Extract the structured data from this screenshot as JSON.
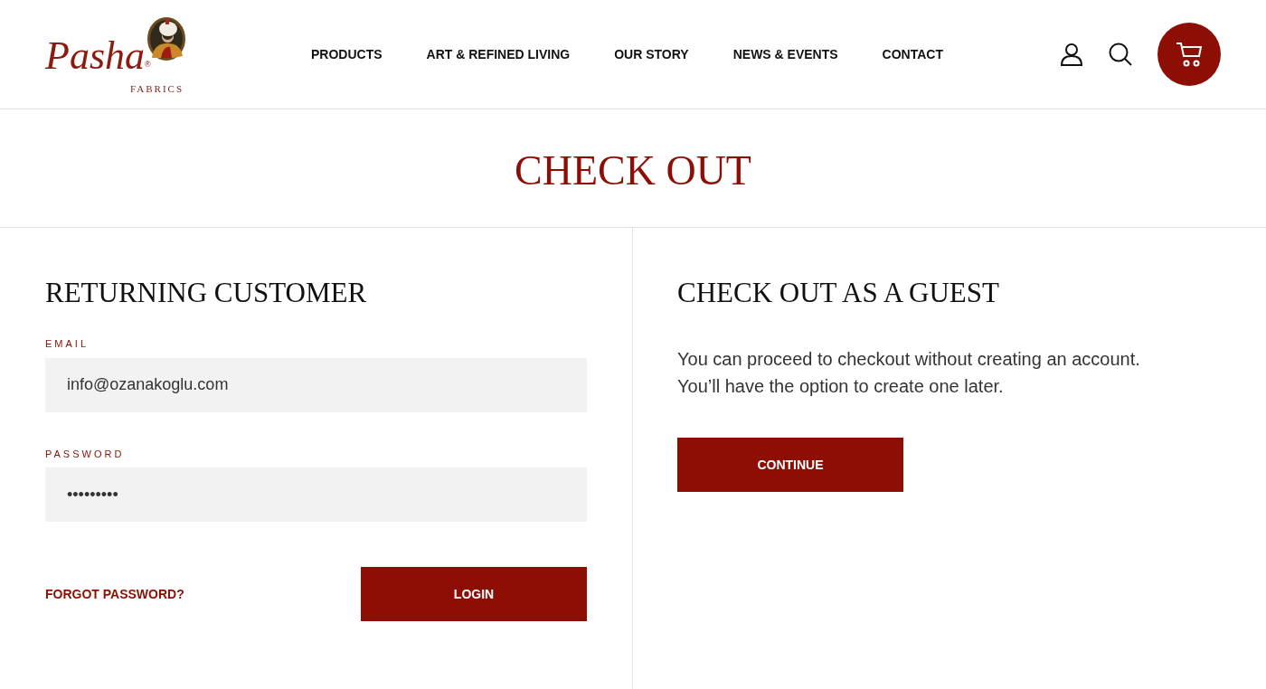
{
  "header": {
    "logo": {
      "wordmark": "Pasha",
      "registered": "®",
      "subtitle": "FABRICS"
    },
    "nav": [
      {
        "label": "PRODUCTS"
      },
      {
        "label": "ART & REFINED LIVING"
      },
      {
        "label": "OUR STORY"
      },
      {
        "label": "NEWS & EVENTS"
      },
      {
        "label": "CONTACT"
      }
    ],
    "actions": [
      {
        "kind": "account"
      },
      {
        "kind": "search"
      },
      {
        "kind": "cart"
      }
    ]
  },
  "page_title": "CHECK OUT",
  "returning_customer": {
    "heading": "RETURNING CUSTOMER",
    "fields": [
      {
        "label": "EMAIL",
        "value": "info@ozanakoglu.com"
      },
      {
        "label": "PASSWORD",
        "value": "•••••••••"
      }
    ],
    "forgot_link": "FORGOT PASSWORD?",
    "button": "LOGIN"
  },
  "guest": {
    "heading": "CHECK OUT AS A GUEST",
    "text": "You can proceed to checkout without creating an account.\nYou’ll have the option to create one later.",
    "button": "CONTINUE"
  }
}
